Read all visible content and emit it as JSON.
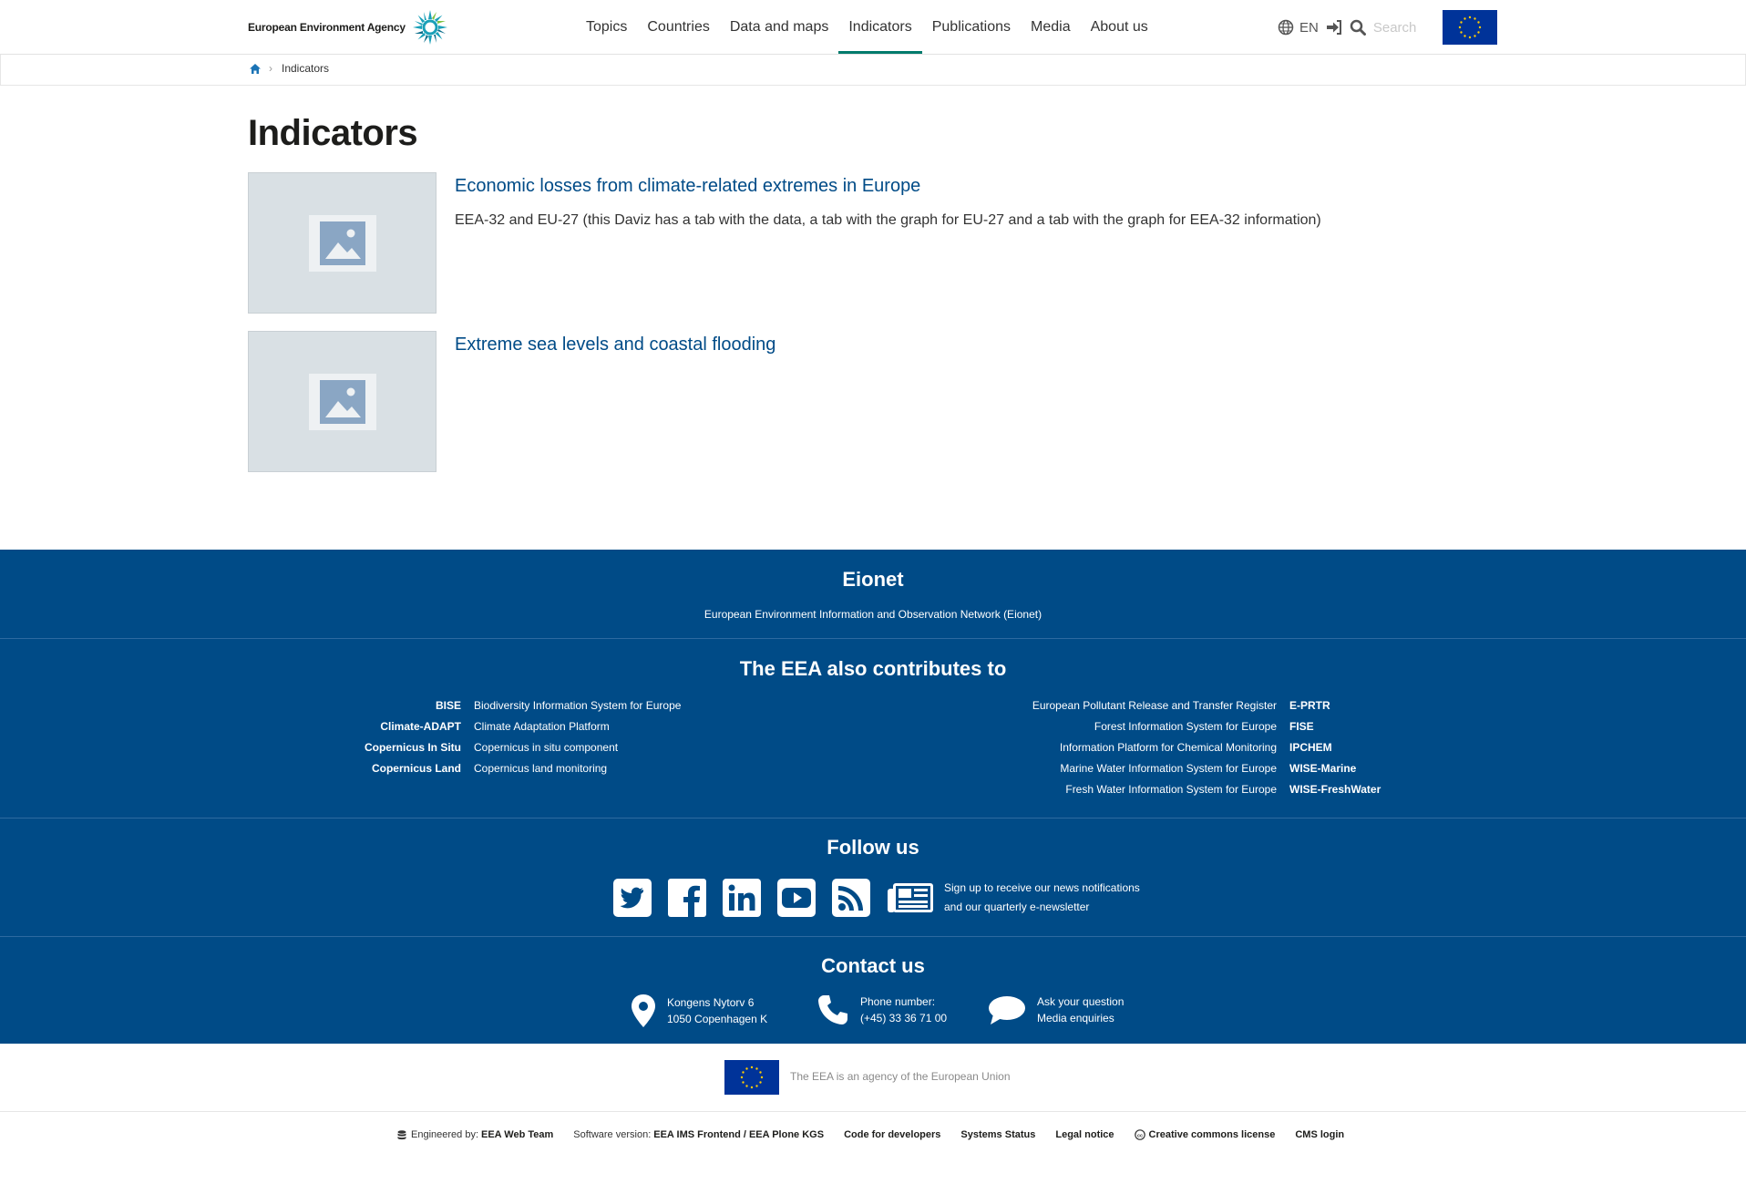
{
  "header": {
    "logo_text": "European Environment Agency",
    "nav": [
      "Topics",
      "Countries",
      "Data and maps",
      "Indicators",
      "Publications",
      "Media",
      "About us"
    ],
    "active_nav": "Indicators",
    "language": "EN",
    "search_placeholder": "Search"
  },
  "breadcrumb": {
    "current": "Indicators"
  },
  "page": {
    "title": "Indicators",
    "items": [
      {
        "title": "Economic losses from climate-related extremes in Europe",
        "description": "EEA-32 and EU-27 (this Daviz has a tab with the data, a tab with the graph for EU-27 and a tab with the graph for EEA-32 information)"
      },
      {
        "title": "Extreme sea levels and coastal flooding",
        "description": ""
      }
    ]
  },
  "footer": {
    "eionet": {
      "title": "Eionet",
      "subtitle": "European Environment Information and Observation Network (Eionet)"
    },
    "contributes": {
      "title": "The EEA also contributes to",
      "left": [
        {
          "abbr": "BISE",
          "name": "Biodiversity Information System for Europe"
        },
        {
          "abbr": "Climate-ADAPT",
          "name": "Climate Adaptation Platform"
        },
        {
          "abbr": "Copernicus In Situ",
          "name": "Copernicus in situ component"
        },
        {
          "abbr": "Copernicus Land",
          "name": "Copernicus land monitoring"
        }
      ],
      "right": [
        {
          "name": "European Pollutant Release and Transfer Register",
          "abbr": "E-PRTR"
        },
        {
          "name": "Forest Information System for Europe",
          "abbr": "FISE"
        },
        {
          "name": "Information Platform for Chemical Monitoring",
          "abbr": "IPCHEM"
        },
        {
          "name": "Marine Water Information System for Europe",
          "abbr": "WISE-Marine"
        },
        {
          "name": "Fresh Water Information System for Europe",
          "abbr": "WISE-FreshWater"
        }
      ]
    },
    "follow": {
      "title": "Follow us",
      "newsletter_line1": "Sign up to receive our news notifications",
      "newsletter_line2": "and our quarterly e-newsletter"
    },
    "contact": {
      "title": "Contact us",
      "address_line1": "Kongens Nytorv 6",
      "address_line2": "1050 Copenhagen K",
      "phone_label": "Phone number:",
      "phone": "(+45) 33 36 71 00",
      "ask": "Ask your question",
      "media": "Media enquiries"
    }
  },
  "eu_caption": "The EEA is an agency of the European Union",
  "bottom": {
    "engineered_label": "Engineered by:",
    "engineered_by": "EEA Web Team",
    "software_label": "Software version:",
    "software": "EEA IMS Frontend / EEA Plone KGS",
    "code": "Code for developers",
    "status": "Systems Status",
    "legal": "Legal notice",
    "cc": "Creative commons license",
    "cms": "CMS login"
  },
  "colors": {
    "footer_bg": "#004b87",
    "link": "#004b87",
    "active_underline": "#007b6c",
    "eu_blue": "#003399"
  }
}
